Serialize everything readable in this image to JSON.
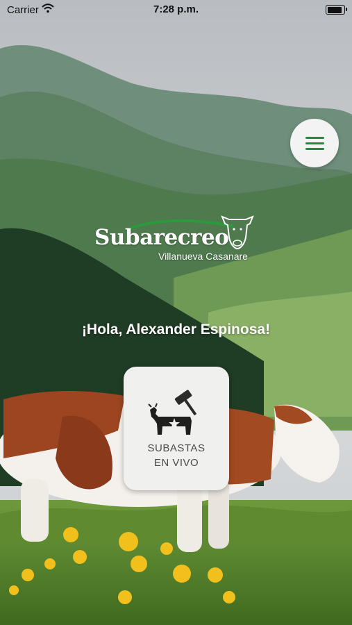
{
  "status_bar": {
    "carrier": "Carrier",
    "time": "7:28 p.m."
  },
  "logo": {
    "brand": "Subarecreo",
    "subtitle": "Villanueva Casanare"
  },
  "greeting": "¡Hola, Alexander Espinosa!",
  "tiles": [
    {
      "label_line1": "SUBASTAS",
      "label_line2": "EN VIVO",
      "icon": "auction-cow-icon"
    }
  ],
  "colors": {
    "accent": "#1e8c3e",
    "tile_bg": "#f0f0ee",
    "menu_bg": "#f2f3f2"
  }
}
